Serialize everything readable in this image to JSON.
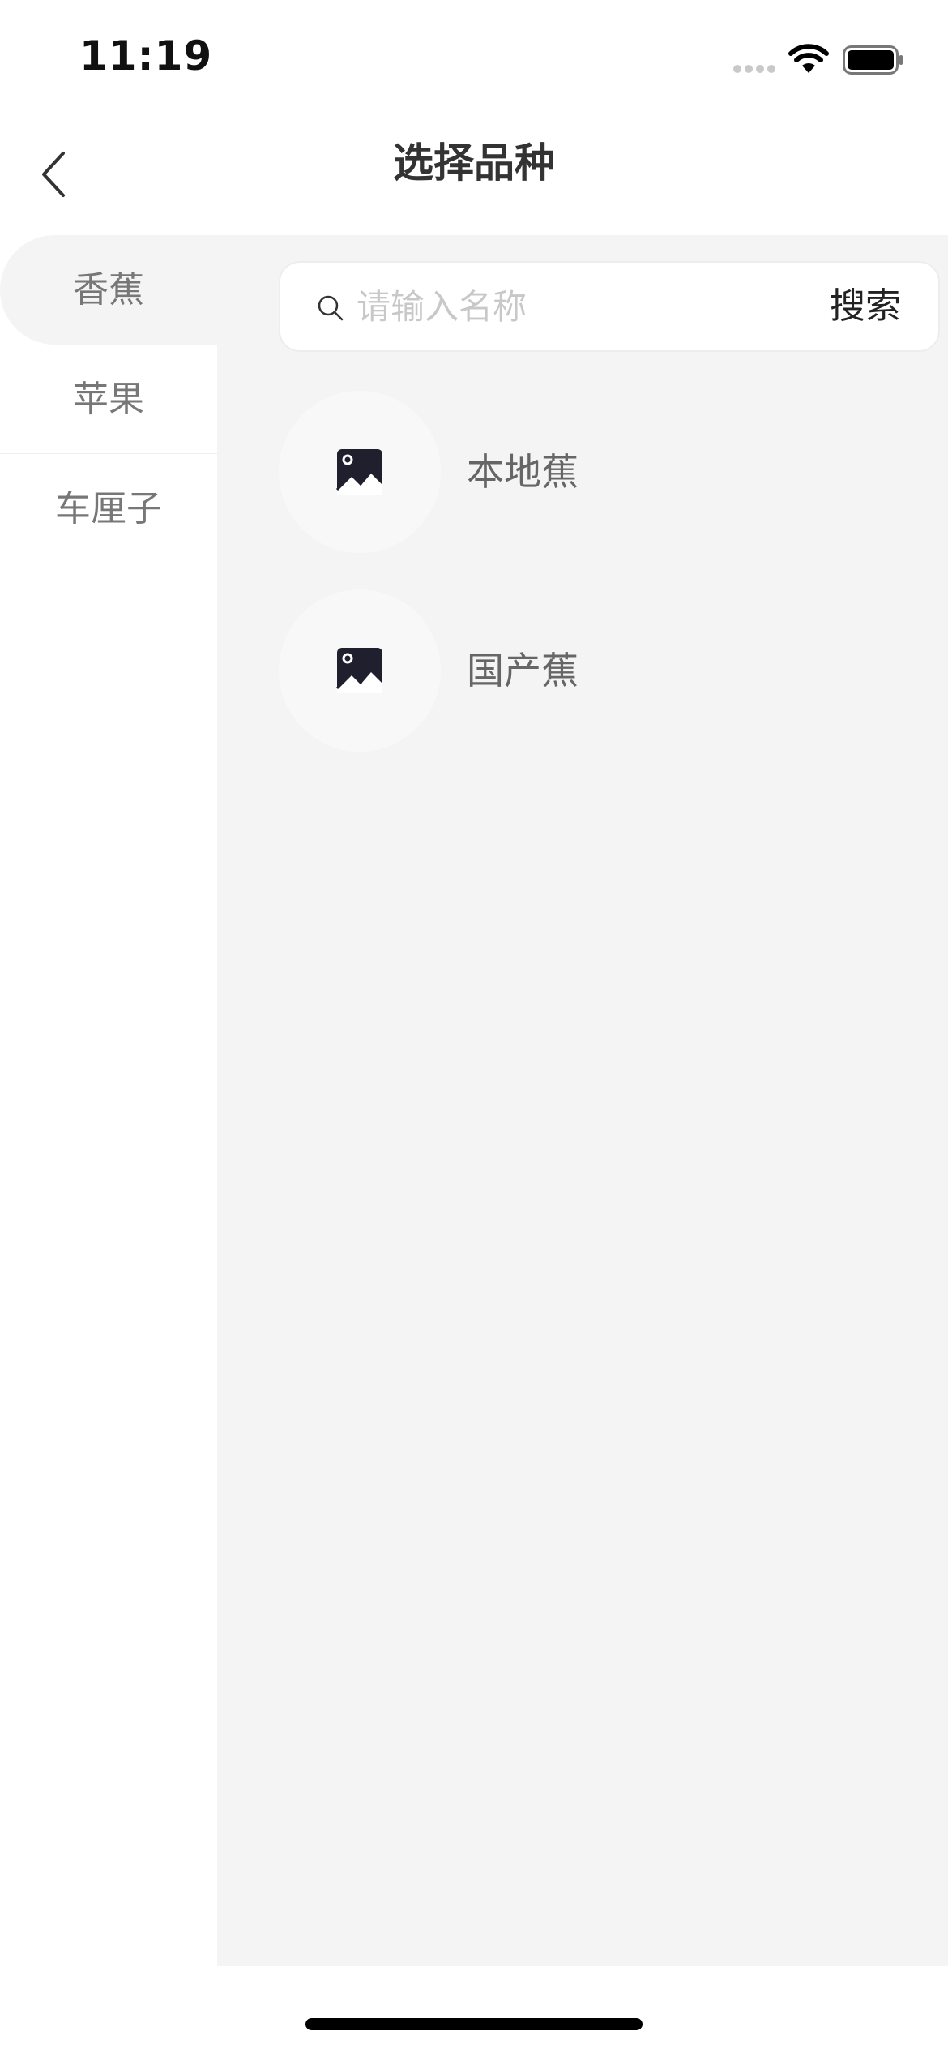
{
  "status_bar": {
    "time": "11:19"
  },
  "header": {
    "title": "选择品种",
    "back_icon": "chevron-left-icon"
  },
  "sidebar": {
    "items": [
      {
        "label": "香蕉",
        "active": true
      },
      {
        "label": "苹果",
        "active": false
      },
      {
        "label": "车厘子",
        "active": false
      }
    ]
  },
  "search": {
    "placeholder": "请输入名称",
    "value": "",
    "button_label": "搜索",
    "icon": "search-icon"
  },
  "varieties": [
    {
      "name": "本地蕉",
      "icon": "image-placeholder-icon"
    },
    {
      "name": "国产蕉",
      "icon": "image-placeholder-icon"
    }
  ],
  "colors": {
    "content_background": "#f4f4f4",
    "active_category_background": "#f4f4f4",
    "title_text": "#333333",
    "muted_text": "#777777",
    "placeholder_text": "#c8c8c8"
  }
}
